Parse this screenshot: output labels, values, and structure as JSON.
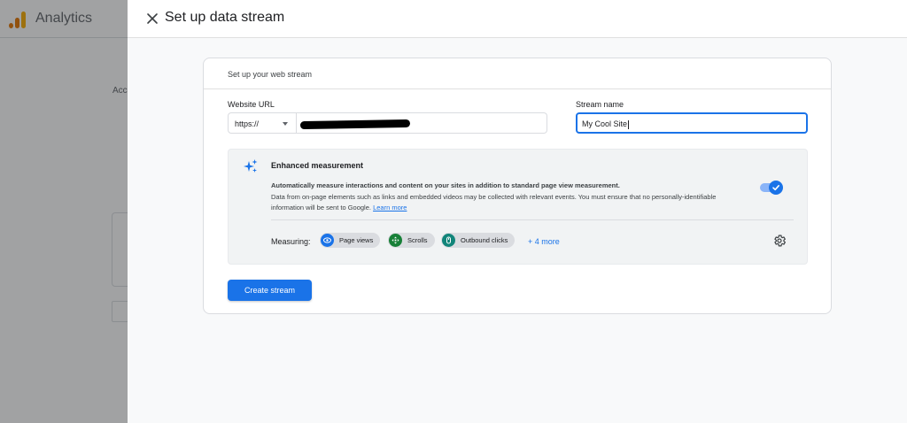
{
  "background": {
    "app_title": "Analytics",
    "account_label_partial": "Acc"
  },
  "sheet": {
    "title": "Set up data stream",
    "close_icon": "close-icon"
  },
  "card": {
    "heading": "Set up your web stream",
    "website_url": {
      "label": "Website URL",
      "protocol_selected": "https://",
      "value_redacted": true
    },
    "stream_name": {
      "label": "Stream name",
      "value": "My Cool Site"
    },
    "enhanced_measurement": {
      "icon": "sparkle-icon",
      "title": "Enhanced measurement",
      "description_bold": "Automatically measure interactions and content on your sites in addition to standard page view measurement.",
      "description": "Data from on-page elements such as links and embedded videos may be collected with relevant events. You must ensure that no personally-identifiable information will be sent to Google.",
      "learn_more": "Learn more",
      "enabled": true,
      "measuring_label": "Measuring:",
      "chips": [
        {
          "label": "Page views",
          "icon": "eye-icon",
          "color": "#1a73e8"
        },
        {
          "label": "Scrolls",
          "icon": "scroll-icon",
          "color": "#188038"
        },
        {
          "label": "Outbound clicks",
          "icon": "outbound-click-icon",
          "color": "#12857a"
        }
      ],
      "more": "+ 4 more",
      "settings_icon": "gear-icon"
    },
    "create_button": "Create stream"
  },
  "colors": {
    "accent": "#1a73e8",
    "scrim": "rgba(32,33,36,0.42)"
  }
}
